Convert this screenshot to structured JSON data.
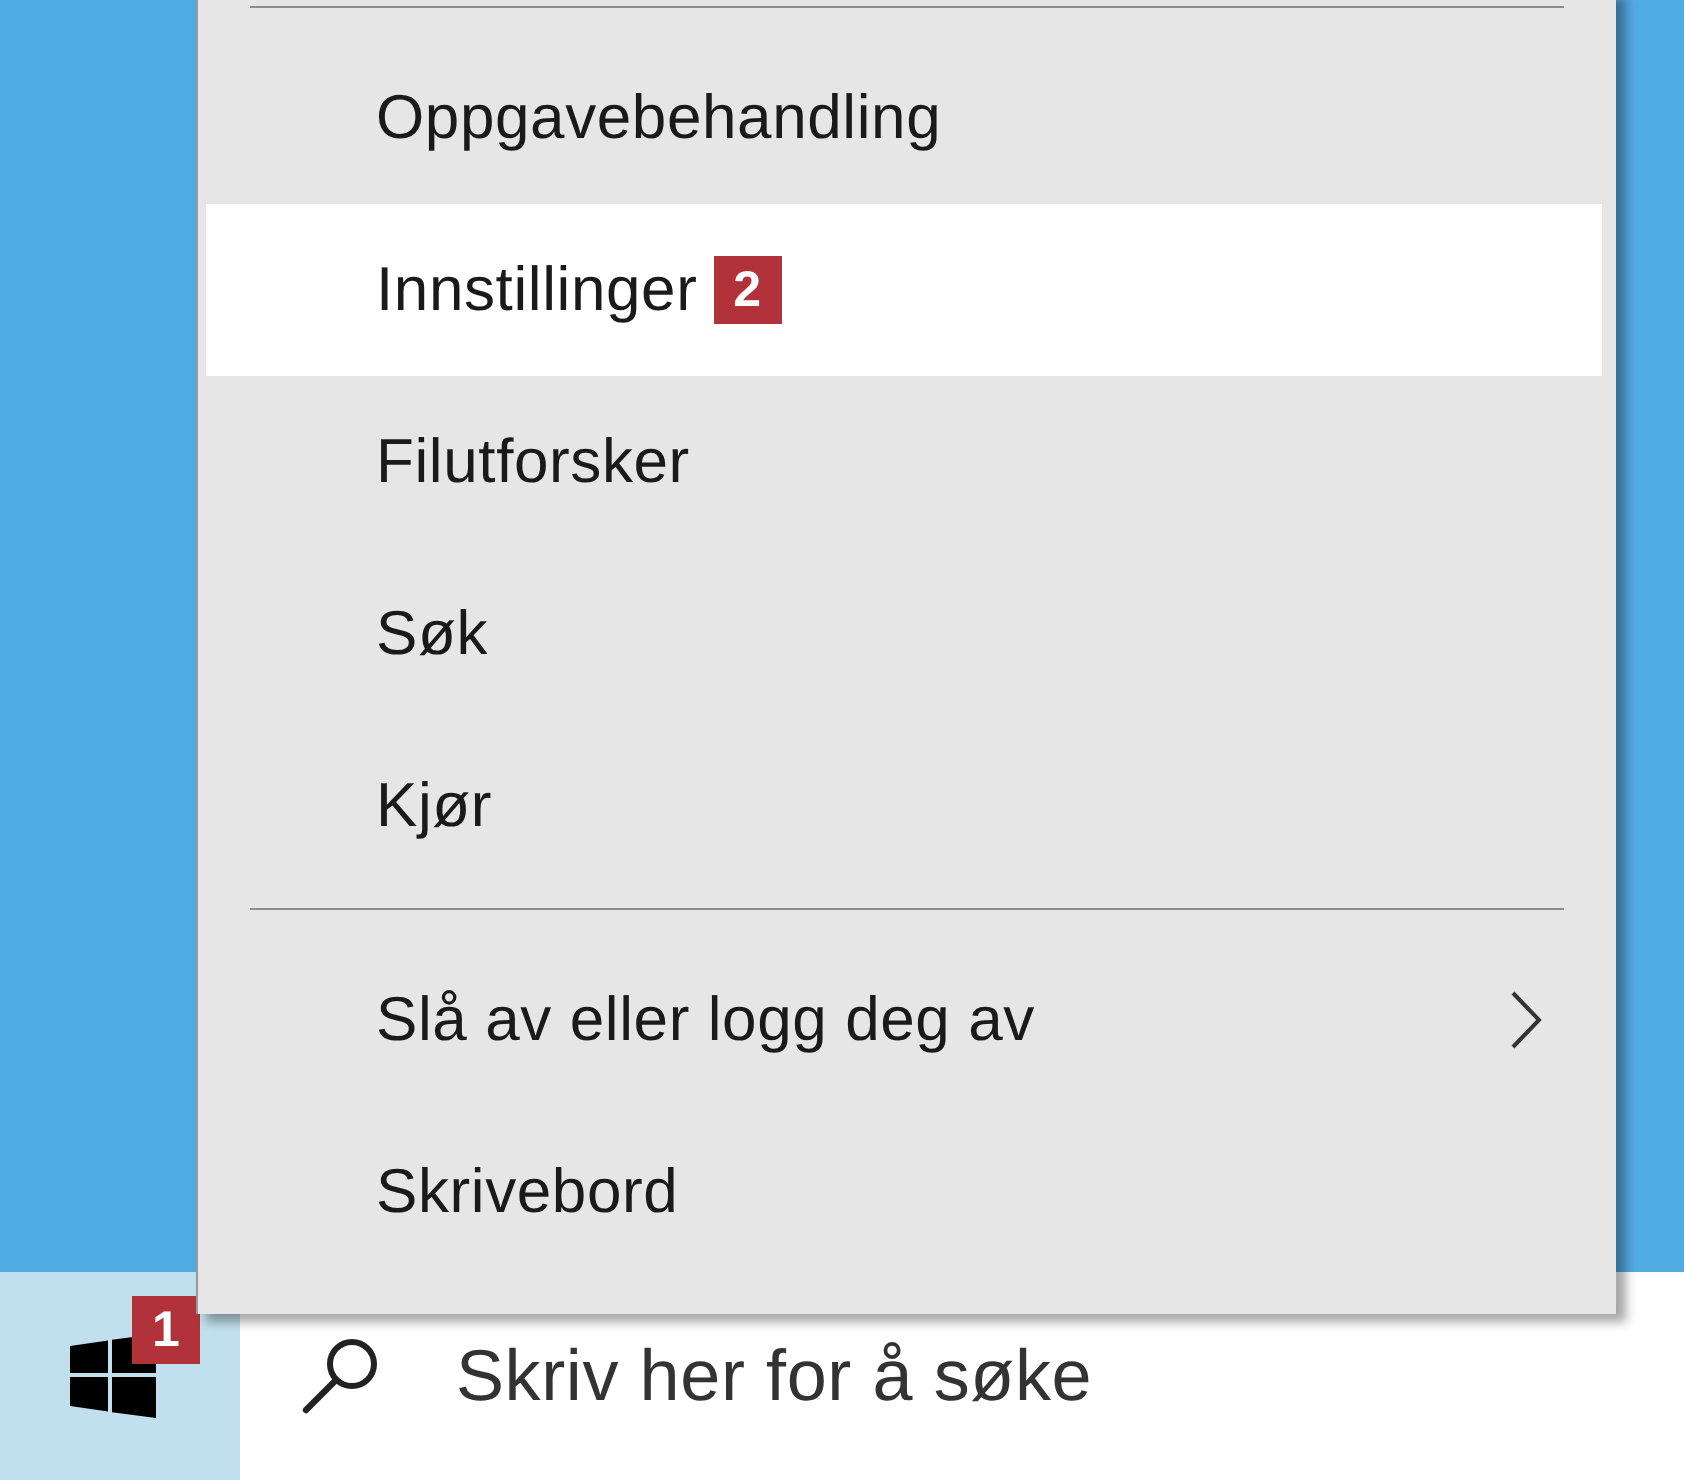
{
  "menu": {
    "groups": [
      {
        "items": [
          {
            "label": "Oppgavebehandling",
            "selected": false,
            "has_submenu": false
          },
          {
            "label": "Innstillinger",
            "selected": true,
            "has_submenu": false,
            "badge": "2"
          },
          {
            "label": "Filutforsker",
            "selected": false,
            "has_submenu": false
          },
          {
            "label": "Søk",
            "selected": false,
            "has_submenu": false
          },
          {
            "label": "Kjør",
            "selected": false,
            "has_submenu": false
          }
        ]
      },
      {
        "items": [
          {
            "label": "Slå av eller logg deg av",
            "selected": false,
            "has_submenu": true
          },
          {
            "label": "Skrivebord",
            "selected": false,
            "has_submenu": false
          }
        ]
      }
    ]
  },
  "taskbar": {
    "start_button": {
      "selected": true,
      "badge": "1"
    },
    "search": {
      "placeholder": "Skriv her for å søke"
    }
  }
}
